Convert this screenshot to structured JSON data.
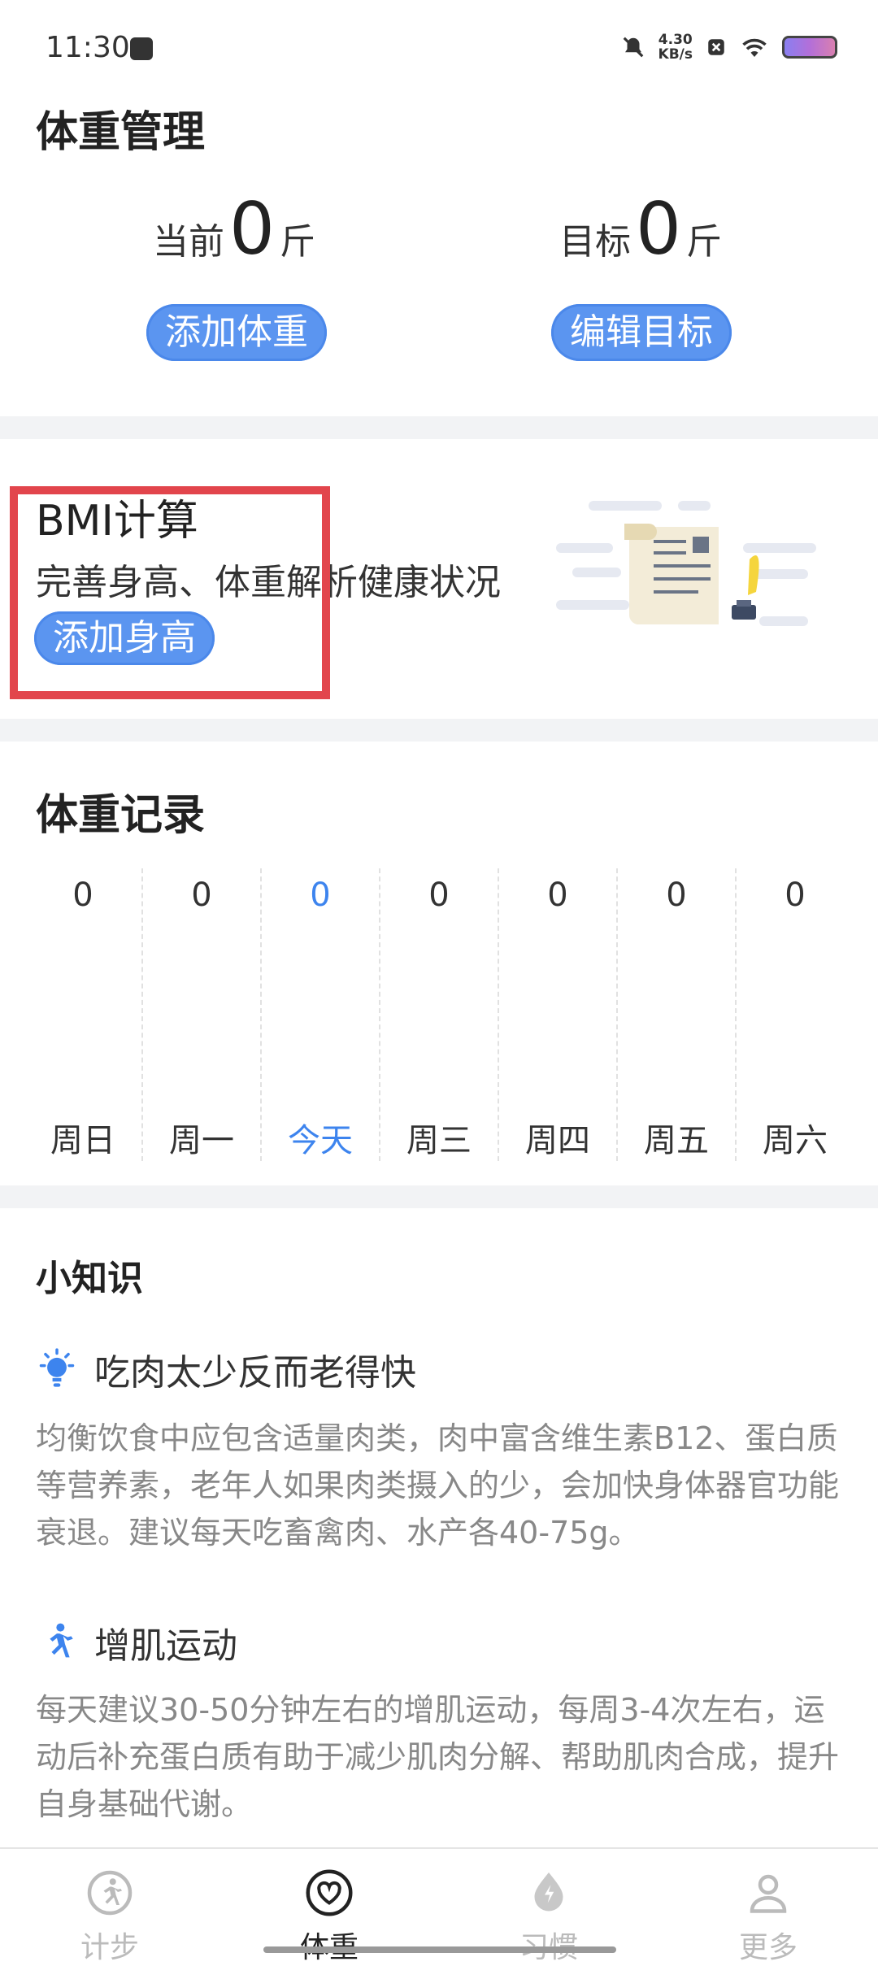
{
  "status": {
    "time": "11:30",
    "net_speed_value": "4.30",
    "net_speed_unit": "KB/s"
  },
  "weight": {
    "title": "体重管理",
    "current_label": "当前",
    "current_value": "0",
    "current_unit": "斤",
    "target_label": "目标",
    "target_value": "0",
    "target_unit": "斤",
    "add_weight_button": "添加体重",
    "edit_target_button": "编辑目标"
  },
  "bmi": {
    "title": "BMI计算",
    "desc": "完善身高、体重解析健康状况",
    "add_height_button": "添加身高"
  },
  "record": {
    "title": "体重记录",
    "days": [
      {
        "name": "周日",
        "value": "0"
      },
      {
        "name": "周一",
        "value": "0"
      },
      {
        "name": "今天",
        "value": "0"
      },
      {
        "name": "周三",
        "value": "0"
      },
      {
        "name": "周四",
        "value": "0"
      },
      {
        "name": "周五",
        "value": "0"
      },
      {
        "name": "周六",
        "value": "0"
      }
    ]
  },
  "tips": {
    "title": "小知识",
    "items": [
      {
        "icon": "lightbulb-icon",
        "title": "吃肉太少反而老得快",
        "body": "均衡饮食中应包含适量肉类，肉中富含维生素B12、蛋白质等营养素，老年人如果肉类摄入的少，会加快身体器官功能衰退。建议每天吃畜禽肉、水产各40-75g。"
      },
      {
        "icon": "running-person-icon",
        "title": "增肌运动",
        "body": "每天建议30-50分钟左右的增肌运动，每周3-4次左右，运动后补充蛋白质有助于减少肌肉分解、帮助肌肉合成，提升自身基础代谢。"
      }
    ]
  },
  "tabs": [
    {
      "label": "计步",
      "icon": "step-icon",
      "active": false
    },
    {
      "label": "体重",
      "icon": "heart-icon",
      "active": true
    },
    {
      "label": "习惯",
      "icon": "drop-icon",
      "active": false
    },
    {
      "label": "更多",
      "icon": "person-icon",
      "active": false
    }
  ],
  "colors": {
    "accent": "#5b95f0",
    "today": "#3d84ee",
    "highlight": "#e2454c"
  }
}
